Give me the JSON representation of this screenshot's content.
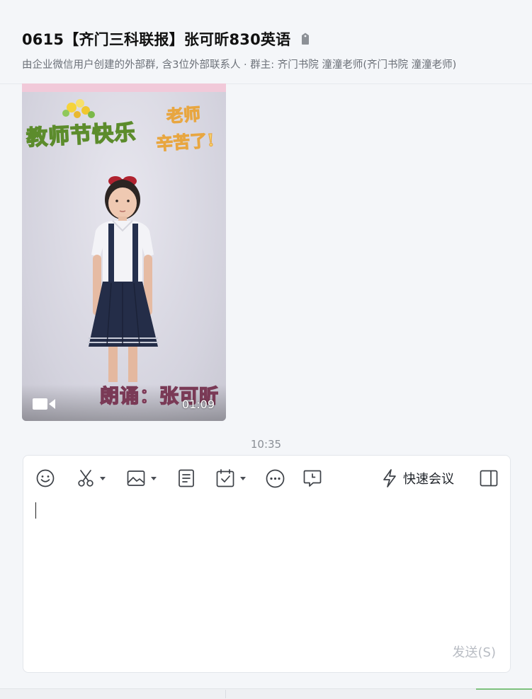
{
  "header": {
    "title": "0615【齐门三科联报】张可昕830英语",
    "subtitle": "由企业微信用户创建的外部群, 含3位外部联系人 · 群主: 齐门书院 潼潼老师(齐门书院 潼潼老师)"
  },
  "message": {
    "video": {
      "overlay_text_left": "教师节快乐",
      "overlay_text_right_line1": "老师",
      "overlay_text_right_line2": "辛苦了!",
      "caption": "朗诵：张可昕",
      "duration": "01:09",
      "icon": "video-camera-icon"
    }
  },
  "time_separator": "10:35",
  "composer": {
    "toolbar": [
      {
        "name": "emoji-icon"
      },
      {
        "name": "scissors-icon",
        "dropdown": true
      },
      {
        "name": "image-icon",
        "dropdown": true
      },
      {
        "name": "document-icon"
      },
      {
        "name": "calendar-check-icon",
        "dropdown": true
      },
      {
        "name": "more-icon"
      },
      {
        "name": "message-clock-icon"
      }
    ],
    "quick_meeting_label": "快速会议",
    "send_label": "发送(S)"
  },
  "colors": {
    "background": "#f4f6f9",
    "send_disabled": "#b8bcc3",
    "accent_green": "#7ec27e"
  }
}
